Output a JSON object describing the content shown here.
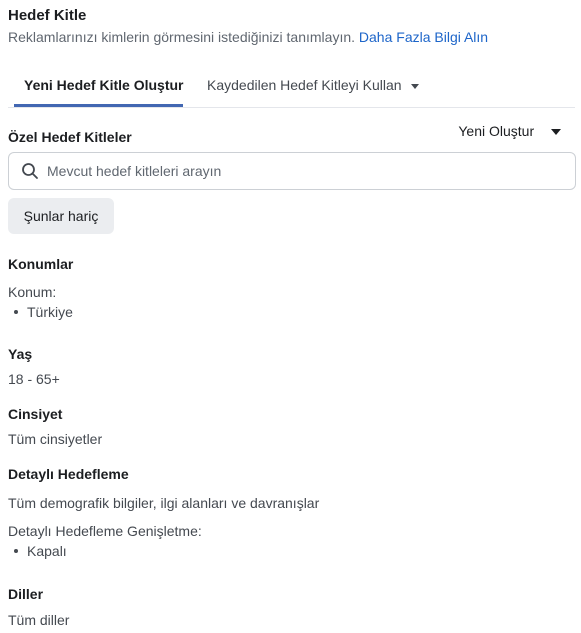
{
  "header": {
    "title": "Hedef Kitle",
    "subtitle": "Reklamlarınızı kimlerin görmesini istediğinizi tanımlayın.",
    "learn_more": "Daha Fazla Bilgi Alın"
  },
  "tabs": [
    {
      "label": "Yeni Hedef Kitle Oluştur",
      "active": true
    },
    {
      "label": "Kaydedilen Hedef Kitleyi Kullan",
      "active": false
    }
  ],
  "custom_audiences": {
    "label": "Özel Hedef Kitleler",
    "create_new": "Yeni Oluştur",
    "search_placeholder": "Mevcut hedef kitleleri arayın",
    "exclude_button": "Şunlar hariç"
  },
  "locations": {
    "heading": "Konumlar",
    "label": "Konum:",
    "items": [
      "Türkiye"
    ]
  },
  "age": {
    "heading": "Yaş",
    "value": "18 - 65+"
  },
  "gender": {
    "heading": "Cinsiyet",
    "value": "Tüm cinsiyetler"
  },
  "detailed_targeting": {
    "heading": "Detaylı Hedefleme",
    "value": "Tüm demografik bilgiler, ilgi alanları ve davranışlar",
    "expansion_label": "Detaylı Hedefleme Genişletme:",
    "expansion_items": [
      "Kapalı"
    ]
  },
  "languages": {
    "heading": "Diller",
    "value": "Tüm diller"
  },
  "colors": {
    "accent": "#4267b2",
    "link": "#1d65c9"
  }
}
